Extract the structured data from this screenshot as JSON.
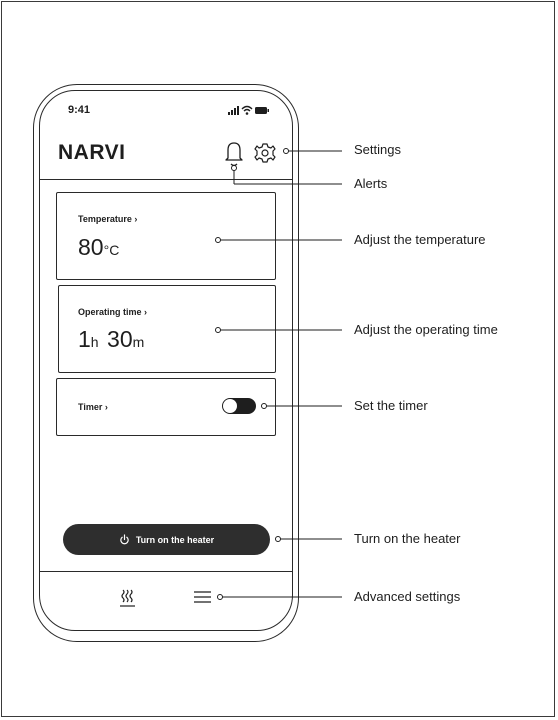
{
  "status": {
    "time": "9:41"
  },
  "app": {
    "brand": "NARVI"
  },
  "cards": {
    "temperature": {
      "label": "Temperature ›",
      "value": "80",
      "unit": "°C"
    },
    "operating_time": {
      "label": "Operating time ›",
      "hours": "1",
      "hours_unit": "h",
      "minutes": "30",
      "minutes_unit": "m"
    },
    "timer": {
      "label": "Timer ›",
      "enabled": false
    }
  },
  "heater_button": {
    "label": "Turn on the heater",
    "icon": "power-icon"
  },
  "bottom_nav": [
    {
      "icon": "heat-waves-icon"
    },
    {
      "icon": "menu-icon"
    }
  ],
  "header_icons": [
    {
      "icon": "bell-icon"
    },
    {
      "icon": "gear-icon"
    }
  ],
  "callouts": {
    "settings": "Settings",
    "alerts": "Alerts",
    "temperature": "Adjust the temperature",
    "operating_time": "Adjust the operating time",
    "timer": "Set the timer",
    "heater": "Turn on the heater",
    "advanced": "Advanced settings"
  }
}
